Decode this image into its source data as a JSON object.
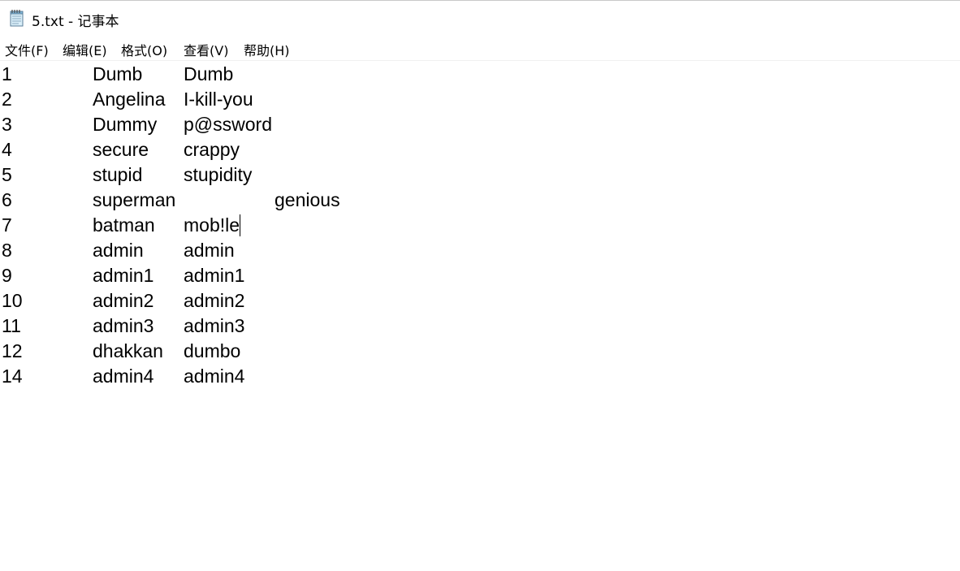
{
  "window": {
    "title": "5.txt - 记事本",
    "icon": "notepad-icon"
  },
  "menu": [
    {
      "label": "文件(F)"
    },
    {
      "label": "编辑(E)"
    },
    {
      "label": "格式(O)"
    },
    {
      "label": "查看(V)"
    },
    {
      "label": "帮助(H)"
    }
  ],
  "document": {
    "lines": [
      {
        "num": "1",
        "user": "Dumb",
        "pass": "Dumb"
      },
      {
        "num": "2",
        "user": "Angelina",
        "pass": "I-kill-you"
      },
      {
        "num": "3",
        "user": "Dummy",
        "pass": "p@ssword"
      },
      {
        "num": "4",
        "user": "secure",
        "pass": "crappy"
      },
      {
        "num": "5",
        "user": "stupid",
        "pass": "stupidity"
      },
      {
        "num": "6",
        "user": "superman",
        "pass": "genious"
      },
      {
        "num": "7",
        "user": "batman",
        "pass": "mob!le"
      },
      {
        "num": "8",
        "user": "admin",
        "pass": "admin"
      },
      {
        "num": "9",
        "user": "admin1",
        "pass": "admin1"
      },
      {
        "num": "10",
        "user": "admin2",
        "pass": "admin2"
      },
      {
        "num": "11",
        "user": "admin3",
        "pass": "admin3"
      },
      {
        "num": "12",
        "user": "dhakkan",
        "pass": "dumbo"
      },
      {
        "num": "14",
        "user": "admin4",
        "pass": "admin4"
      }
    ]
  }
}
